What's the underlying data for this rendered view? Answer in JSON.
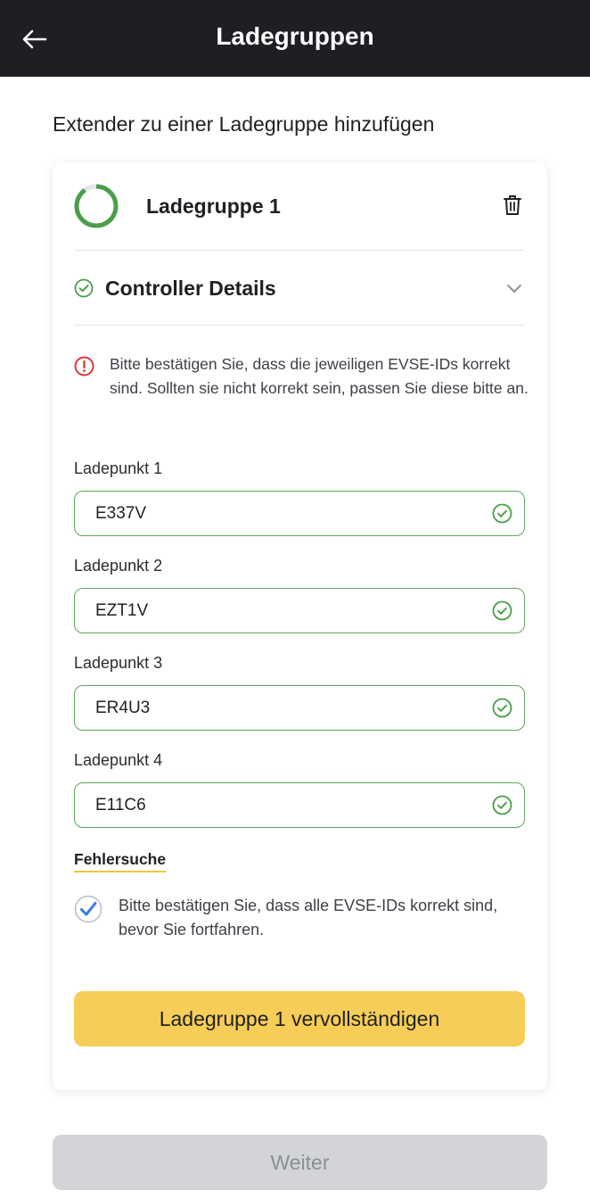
{
  "appbar": {
    "title": "Ladegruppen",
    "back_icon": "arrow-left-icon"
  },
  "section": {
    "heading": "Extender zu einer Ladegruppe hinzufügen"
  },
  "group": {
    "title": "Ladegruppe 1",
    "progress_fraction": 0.9,
    "progress_color": "#4a9e4a",
    "delete_icon": "trash-icon"
  },
  "controller": {
    "label": "Controller Details",
    "status_icon": "check-circle-icon",
    "expand_icon": "chevron-down-icon"
  },
  "warning": {
    "icon": "alert-circle-icon",
    "color": "#d93434",
    "text": "Bitte bestätigen Sie, dass die jeweiligen EVSE-IDs korrekt sind. Sollten sie nicht korrekt sein, passen Sie diese bitte an."
  },
  "chargepoints": [
    {
      "label": "Ladepunkt 1",
      "value": "E337V"
    },
    {
      "label": "Ladepunkt 2",
      "value": "EZT1V"
    },
    {
      "label": "Ladepunkt 3",
      "value": "ER4U3"
    },
    {
      "label": "Ladepunkt 4",
      "value": "E11C6"
    }
  ],
  "troubleshooting": {
    "label": "Fehlersuche"
  },
  "confirmation": {
    "checked": true,
    "text": "Bitte bestätigen Sie, dass alle EVSE-IDs korrekt sind, bevor Sie fortfahren."
  },
  "actions": {
    "complete_label": "Ladegruppe 1 vervollständigen",
    "next_label": "Weiter"
  },
  "colors": {
    "appbar": "#1d1f24",
    "success": "#4a9e4a",
    "accent": "#f6cd56",
    "checkbox": "#3b7be0",
    "disabled": "#d2d4d8"
  }
}
